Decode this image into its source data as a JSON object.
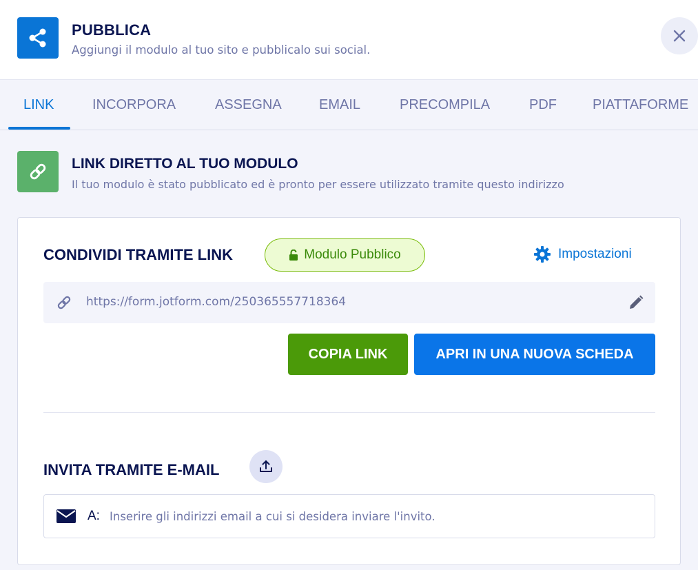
{
  "header": {
    "title": "PUBBLICA",
    "subtitle": "Aggiungi il modulo al tuo sito e pubblicalo sui social.",
    "icon": "share-icon"
  },
  "tabs": [
    {
      "label": "LINK",
      "active": true
    },
    {
      "label": "INCORPORA",
      "active": false
    },
    {
      "label": "ASSEGNA",
      "active": false
    },
    {
      "label": "EMAIL",
      "active": false
    },
    {
      "label": "PRECOMPILA",
      "active": false
    },
    {
      "label": "PDF",
      "active": false
    },
    {
      "label": "PIATTAFORME",
      "active": false
    }
  ],
  "direct_link": {
    "title": "LINK DIRETTO AL TUO MODULO",
    "subtitle": "Il tuo modulo è stato pubblicato ed è pronto per essere utilizzato tramite questo indirizzo",
    "icon": "link-icon"
  },
  "share": {
    "title": "CONDIVIDI TRAMITE LINK",
    "badge_label": "Modulo Pubblico",
    "settings_label": "Impostazioni",
    "url": "https://form.jotform.com/250365557718364",
    "copy_label": "COPIA LINK",
    "open_label": "APRI IN UNA NUOVA SCHEDA"
  },
  "invite": {
    "title": "INVITA TRAMITE E-MAIL",
    "to_label": "A:",
    "placeholder": "Inserire gli indirizzi email a cui si desidera inviare l'invito."
  },
  "colors": {
    "brand_blue": "#0a75d6",
    "green_icon": "#5bb16b",
    "copy_green": "#4b9a09",
    "badge_bg": "#edfbd3",
    "navy": "#0a1551",
    "muted": "#6f76a7"
  }
}
